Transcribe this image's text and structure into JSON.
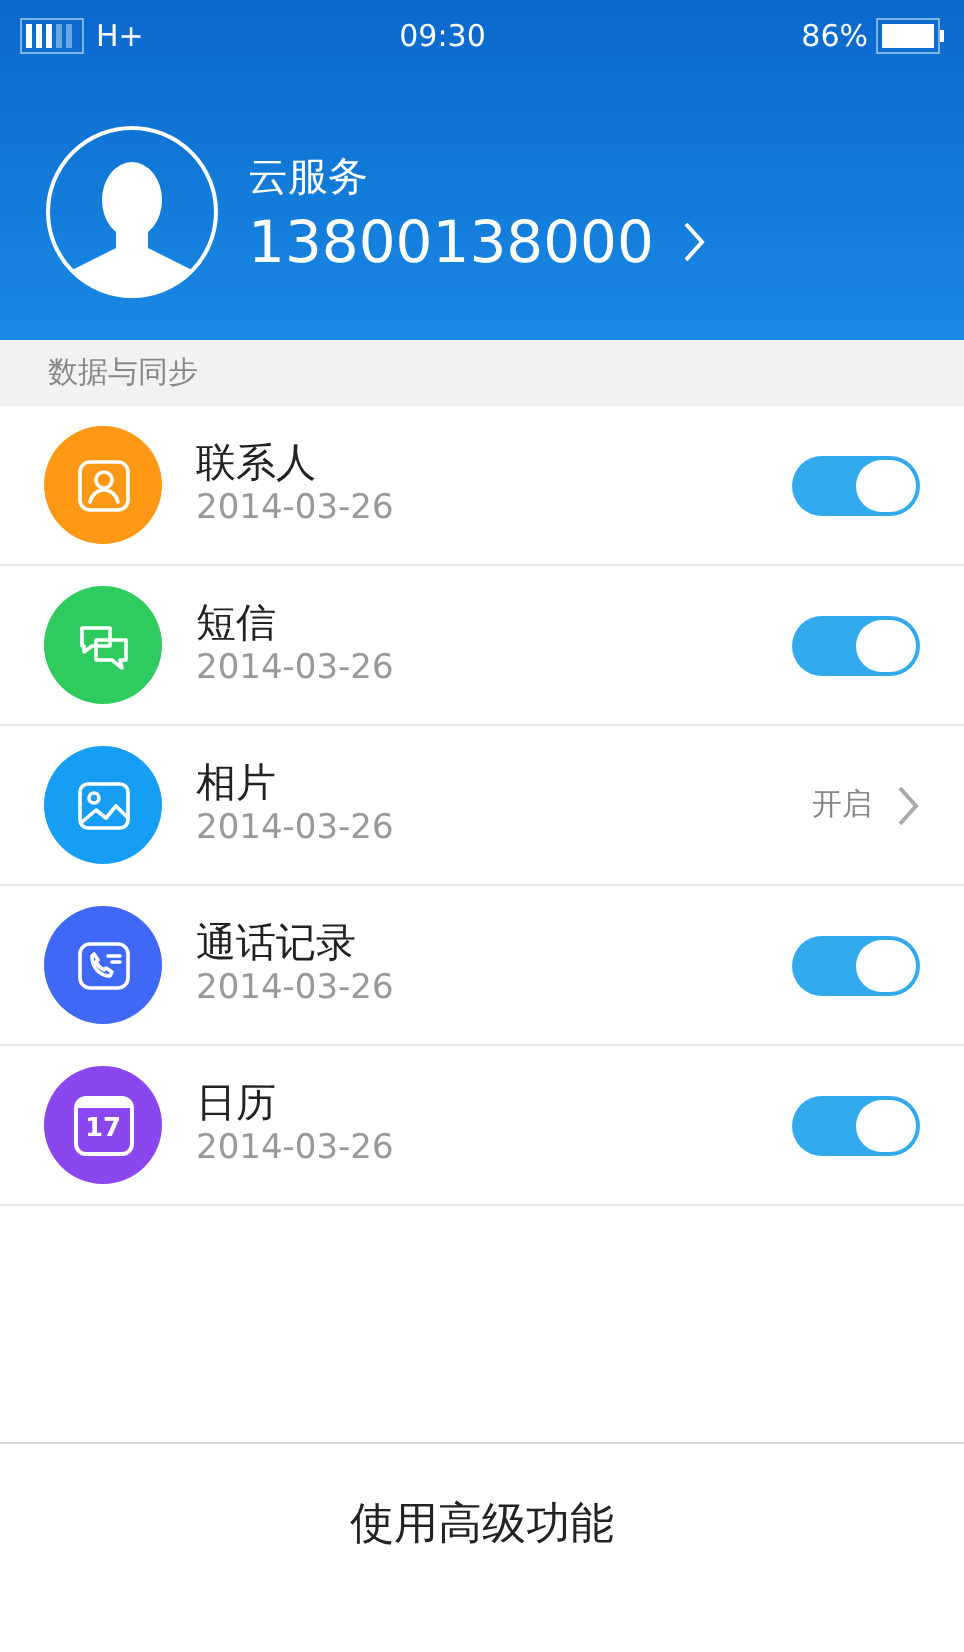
{
  "status_bar": {
    "network": "H+",
    "time": "09:30",
    "battery": "86%"
  },
  "account": {
    "title": "云服务",
    "phone": "13800138000"
  },
  "section": {
    "title": "数据与同步"
  },
  "items": [
    {
      "kind": "toggle",
      "label": "联系人",
      "date": "2014-03-26",
      "on": true,
      "color": "#ff9814"
    },
    {
      "kind": "toggle",
      "label": "短信",
      "date": "2014-03-26",
      "on": true,
      "color": "#2fcb5e"
    },
    {
      "kind": "link",
      "label": "相片",
      "date": "2014-03-26",
      "status": "开启",
      "color": "#169ef5"
    },
    {
      "kind": "toggle",
      "label": "通话记录",
      "date": "2014-03-26",
      "on": true,
      "color": "#4068f6"
    },
    {
      "kind": "toggle",
      "label": "日历",
      "date": "2014-03-26",
      "on": true,
      "color": "#8b46f0",
      "icon_text": "17"
    }
  ],
  "footer_button": "使用高级功能"
}
